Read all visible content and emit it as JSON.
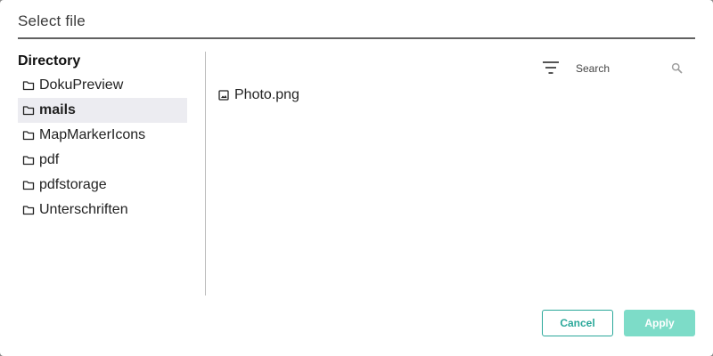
{
  "dialog": {
    "title": "Select file"
  },
  "directory": {
    "heading": "Directory",
    "items": [
      {
        "label": "DokuPreview",
        "icon": "folder-icon",
        "selected": false
      },
      {
        "label": "mails",
        "icon": "folder-icon",
        "selected": true
      },
      {
        "label": "MapMarkerIcons",
        "icon": "folder-icon",
        "selected": false
      },
      {
        "label": "pdf",
        "icon": "folder-icon",
        "selected": false
      },
      {
        "label": "pdfstorage",
        "icon": "folder-icon",
        "selected": false
      },
      {
        "label": "Unterschriften",
        "icon": "folder-icon",
        "selected": false
      }
    ]
  },
  "toolbar": {
    "filter_icon": "filter-icon",
    "search": {
      "placeholder": "Search",
      "value": "",
      "icon": "search-icon"
    }
  },
  "files": [
    {
      "name": "Photo.png",
      "icon": "image-icon"
    }
  ],
  "actions": {
    "cancel_label": "Cancel",
    "apply_label": "Apply",
    "apply_enabled": false
  },
  "colors": {
    "accent": "#2ba89a",
    "apply_disabled": "#7ddcc8",
    "selected_row": "#ececf1",
    "title_rule": "#616161"
  }
}
